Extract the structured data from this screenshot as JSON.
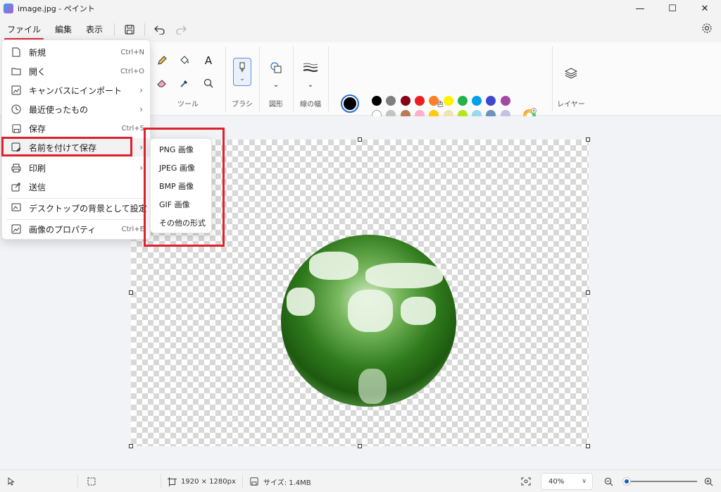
{
  "window": {
    "title": "image.jpg - ペイント",
    "minimize": "—",
    "maximize": "☐",
    "close": "✕"
  },
  "menubar": {
    "items": [
      {
        "label": "ファイル"
      },
      {
        "label": "編集"
      },
      {
        "label": "表示"
      }
    ]
  },
  "ribbon": {
    "groups": {
      "tools": "ツール",
      "brush": "ブラシ",
      "shapes": "図形",
      "stroke": "線の幅",
      "colors": "色",
      "layers": "レイヤー"
    },
    "text_tool": "A",
    "colors": {
      "current_primary": "#000000",
      "current_secondary": "#ffffff",
      "row1": [
        "#000000",
        "#7f7f7f",
        "#880015",
        "#ed1c24",
        "#ff7f27",
        "#fff200",
        "#22b14c",
        "#00a2e8",
        "#3f48cc",
        "#a349a4"
      ],
      "row2": [
        "#ffffff",
        "#c3c3c3",
        "#b97a57",
        "#ffaec9",
        "#ffc90e",
        "#efe4b0",
        "#b5e61d",
        "#99d9ea",
        "#7092be",
        "#c8bfe7"
      ]
    }
  },
  "file_menu": {
    "items": [
      {
        "icon": "new-file-icon",
        "label": "新規",
        "shortcut": "Ctrl+N"
      },
      {
        "icon": "open-folder-icon",
        "label": "開く",
        "shortcut": "Ctrl+O"
      },
      {
        "icon": "import-icon",
        "label": "キャンバスにインポート",
        "arrow": "›"
      },
      {
        "icon": "clock-icon",
        "label": "最近使ったもの",
        "arrow": "›"
      },
      {
        "icon": "save-icon",
        "label": "保存",
        "shortcut": "Ctrl+S"
      },
      {
        "icon": "save-as-icon",
        "label": "名前を付けて保存",
        "arrow": "›"
      },
      {
        "icon": "print-icon",
        "label": "印刷",
        "arrow": "›"
      },
      {
        "icon": "share-icon",
        "label": "送信"
      },
      {
        "icon": "desktop-background-icon",
        "label": "デスクトップの背景として設定",
        "arrow": "›"
      },
      {
        "icon": "image-properties-icon",
        "label": "画像のプロパティ",
        "shortcut": "Ctrl+E"
      }
    ]
  },
  "save_as_submenu": {
    "items": [
      "PNG 画像",
      "JPEG 画像",
      "BMP 画像",
      "GIF 画像",
      "その他の形式"
    ]
  },
  "statusbar": {
    "dimensions": "1920 × 1280px",
    "size": "サイズ: 1.4MB",
    "zoom": "40%",
    "zoom_level": 0.4
  }
}
